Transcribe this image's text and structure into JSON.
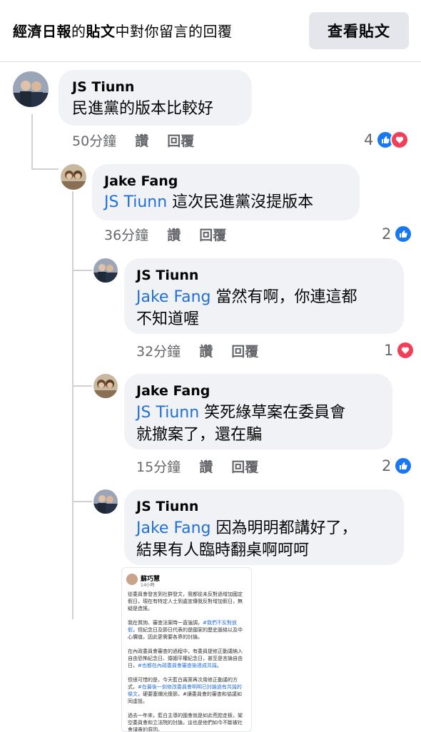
{
  "header": {
    "title_parts": [
      "經濟日報",
      "的",
      "貼文",
      "中對你留言的回覆"
    ],
    "view_post_button": "查看貼文"
  },
  "comments": [
    {
      "author": "JS Tiunn",
      "mention": "",
      "text_lines": [
        "民進黨的版本比較好"
      ],
      "time": "50分鐘",
      "like_label": "讚",
      "reply_label": "回覆",
      "reaction_count": "4",
      "reactions": [
        "like-icon",
        "love-icon"
      ]
    },
    {
      "author": "Jake Fang",
      "mention": "JS Tiunn",
      "text_lines": [
        "這次民進黨沒提版本"
      ],
      "time": "36分鐘",
      "like_label": "讚",
      "reply_label": "回覆",
      "reaction_count": "2",
      "reactions": [
        "like-icon"
      ]
    },
    {
      "author": "JS Tiunn",
      "mention": "Jake Fang",
      "text_lines": [
        "當然有啊，你連這都",
        "不知道喔"
      ],
      "time": "32分鐘",
      "like_label": "讚",
      "reply_label": "回覆",
      "reaction_count": "1",
      "reactions": [
        "love-icon"
      ]
    },
    {
      "author": "Jake Fang",
      "mention": "JS Tiunn",
      "text_lines": [
        "笑死綠草案在委員會",
        "就撤案了，還在騙"
      ],
      "time": "15分鐘",
      "like_label": "讚",
      "reply_label": "回覆",
      "reaction_count": "2",
      "reactions": [
        "like-icon"
      ]
    },
    {
      "author": "JS Tiunn",
      "mention": "Jake Fang",
      "text_lines": [
        "因為明明都講好了，",
        "結果有人臨時翻桌啊呵呵"
      ],
      "time": "",
      "like_label": "",
      "reply_label": "",
      "reaction_count": "",
      "reactions": []
    }
  ],
  "shared_post": {
    "author": "蘇巧慧",
    "date": "14小時",
    "paragraphs": [
      {
        "text": "從委員會發言到社群發文，我都從未反對過增加國定假日，現在有特定人士到處宣傳我反對增加假日，無疑是造謠。",
        "highlight": ""
      },
      {
        "text": "我在質詢、審查法案時一直強調，",
        "highlight": "#我們不反對放假",
        "after": "，但紀念日及節日代表的是國家的歷史脈絡以及中心價值，因此更需要各界的討論。"
      },
      {
        "text": "在內政委員會審查的過程中，有委員提修正動議納入自由恐怖紀念日、婚姻平權紀念日，甚至是言論自由日，",
        "highlight": "#也都在內政委員會審查後達成共識",
        "after": "。"
      },
      {
        "text": "但很可惜的是，今天藍白兩黨再次用修正動議的方式，",
        "highlight": "#在最後一刻修改委員會明明已討論過有共識的條文",
        "after": "，硬要塞爛光復節，#讓委員會的審查和協議如同虛設。"
      },
      {
        "text": "過去一年來，藍白主導的國會就是如此荒腔走板，架空委員會和立法院的討論，這也是他們如今不斷被社會譴責的原因。",
        "highlight": ""
      }
    ]
  },
  "colors": {
    "mention": "#216fdb",
    "like": "#1877f2",
    "love": "#f33e58",
    "bubble": "#f0f2f5"
  }
}
